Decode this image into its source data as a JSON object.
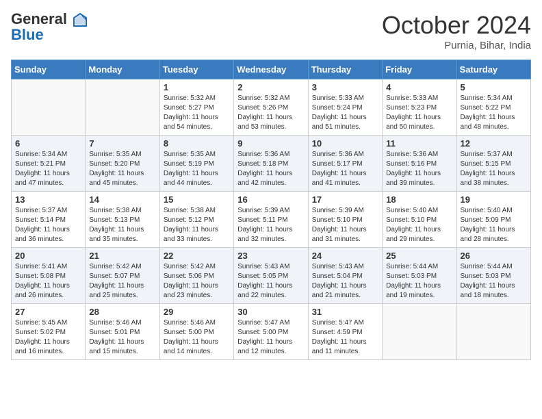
{
  "header": {
    "logo_line1": "General",
    "logo_line2": "Blue",
    "month": "October 2024",
    "location": "Purnia, Bihar, India"
  },
  "days_of_week": [
    "Sunday",
    "Monday",
    "Tuesday",
    "Wednesday",
    "Thursday",
    "Friday",
    "Saturday"
  ],
  "weeks": [
    [
      {
        "day": "",
        "content": ""
      },
      {
        "day": "",
        "content": ""
      },
      {
        "day": "1",
        "content": "Sunrise: 5:32 AM\nSunset: 5:27 PM\nDaylight: 11 hours and 54 minutes."
      },
      {
        "day": "2",
        "content": "Sunrise: 5:32 AM\nSunset: 5:26 PM\nDaylight: 11 hours and 53 minutes."
      },
      {
        "day": "3",
        "content": "Sunrise: 5:33 AM\nSunset: 5:24 PM\nDaylight: 11 hours and 51 minutes."
      },
      {
        "day": "4",
        "content": "Sunrise: 5:33 AM\nSunset: 5:23 PM\nDaylight: 11 hours and 50 minutes."
      },
      {
        "day": "5",
        "content": "Sunrise: 5:34 AM\nSunset: 5:22 PM\nDaylight: 11 hours and 48 minutes."
      }
    ],
    [
      {
        "day": "6",
        "content": "Sunrise: 5:34 AM\nSunset: 5:21 PM\nDaylight: 11 hours and 47 minutes."
      },
      {
        "day": "7",
        "content": "Sunrise: 5:35 AM\nSunset: 5:20 PM\nDaylight: 11 hours and 45 minutes."
      },
      {
        "day": "8",
        "content": "Sunrise: 5:35 AM\nSunset: 5:19 PM\nDaylight: 11 hours and 44 minutes."
      },
      {
        "day": "9",
        "content": "Sunrise: 5:36 AM\nSunset: 5:18 PM\nDaylight: 11 hours and 42 minutes."
      },
      {
        "day": "10",
        "content": "Sunrise: 5:36 AM\nSunset: 5:17 PM\nDaylight: 11 hours and 41 minutes."
      },
      {
        "day": "11",
        "content": "Sunrise: 5:36 AM\nSunset: 5:16 PM\nDaylight: 11 hours and 39 minutes."
      },
      {
        "day": "12",
        "content": "Sunrise: 5:37 AM\nSunset: 5:15 PM\nDaylight: 11 hours and 38 minutes."
      }
    ],
    [
      {
        "day": "13",
        "content": "Sunrise: 5:37 AM\nSunset: 5:14 PM\nDaylight: 11 hours and 36 minutes."
      },
      {
        "day": "14",
        "content": "Sunrise: 5:38 AM\nSunset: 5:13 PM\nDaylight: 11 hours and 35 minutes."
      },
      {
        "day": "15",
        "content": "Sunrise: 5:38 AM\nSunset: 5:12 PM\nDaylight: 11 hours and 33 minutes."
      },
      {
        "day": "16",
        "content": "Sunrise: 5:39 AM\nSunset: 5:11 PM\nDaylight: 11 hours and 32 minutes."
      },
      {
        "day": "17",
        "content": "Sunrise: 5:39 AM\nSunset: 5:10 PM\nDaylight: 11 hours and 31 minutes."
      },
      {
        "day": "18",
        "content": "Sunrise: 5:40 AM\nSunset: 5:10 PM\nDaylight: 11 hours and 29 minutes."
      },
      {
        "day": "19",
        "content": "Sunrise: 5:40 AM\nSunset: 5:09 PM\nDaylight: 11 hours and 28 minutes."
      }
    ],
    [
      {
        "day": "20",
        "content": "Sunrise: 5:41 AM\nSunset: 5:08 PM\nDaylight: 11 hours and 26 minutes."
      },
      {
        "day": "21",
        "content": "Sunrise: 5:42 AM\nSunset: 5:07 PM\nDaylight: 11 hours and 25 minutes."
      },
      {
        "day": "22",
        "content": "Sunrise: 5:42 AM\nSunset: 5:06 PM\nDaylight: 11 hours and 23 minutes."
      },
      {
        "day": "23",
        "content": "Sunrise: 5:43 AM\nSunset: 5:05 PM\nDaylight: 11 hours and 22 minutes."
      },
      {
        "day": "24",
        "content": "Sunrise: 5:43 AM\nSunset: 5:04 PM\nDaylight: 11 hours and 21 minutes."
      },
      {
        "day": "25",
        "content": "Sunrise: 5:44 AM\nSunset: 5:03 PM\nDaylight: 11 hours and 19 minutes."
      },
      {
        "day": "26",
        "content": "Sunrise: 5:44 AM\nSunset: 5:03 PM\nDaylight: 11 hours and 18 minutes."
      }
    ],
    [
      {
        "day": "27",
        "content": "Sunrise: 5:45 AM\nSunset: 5:02 PM\nDaylight: 11 hours and 16 minutes."
      },
      {
        "day": "28",
        "content": "Sunrise: 5:46 AM\nSunset: 5:01 PM\nDaylight: 11 hours and 15 minutes."
      },
      {
        "day": "29",
        "content": "Sunrise: 5:46 AM\nSunset: 5:00 PM\nDaylight: 11 hours and 14 minutes."
      },
      {
        "day": "30",
        "content": "Sunrise: 5:47 AM\nSunset: 5:00 PM\nDaylight: 11 hours and 12 minutes."
      },
      {
        "day": "31",
        "content": "Sunrise: 5:47 AM\nSunset: 4:59 PM\nDaylight: 11 hours and 11 minutes."
      },
      {
        "day": "",
        "content": ""
      },
      {
        "day": "",
        "content": ""
      }
    ]
  ]
}
